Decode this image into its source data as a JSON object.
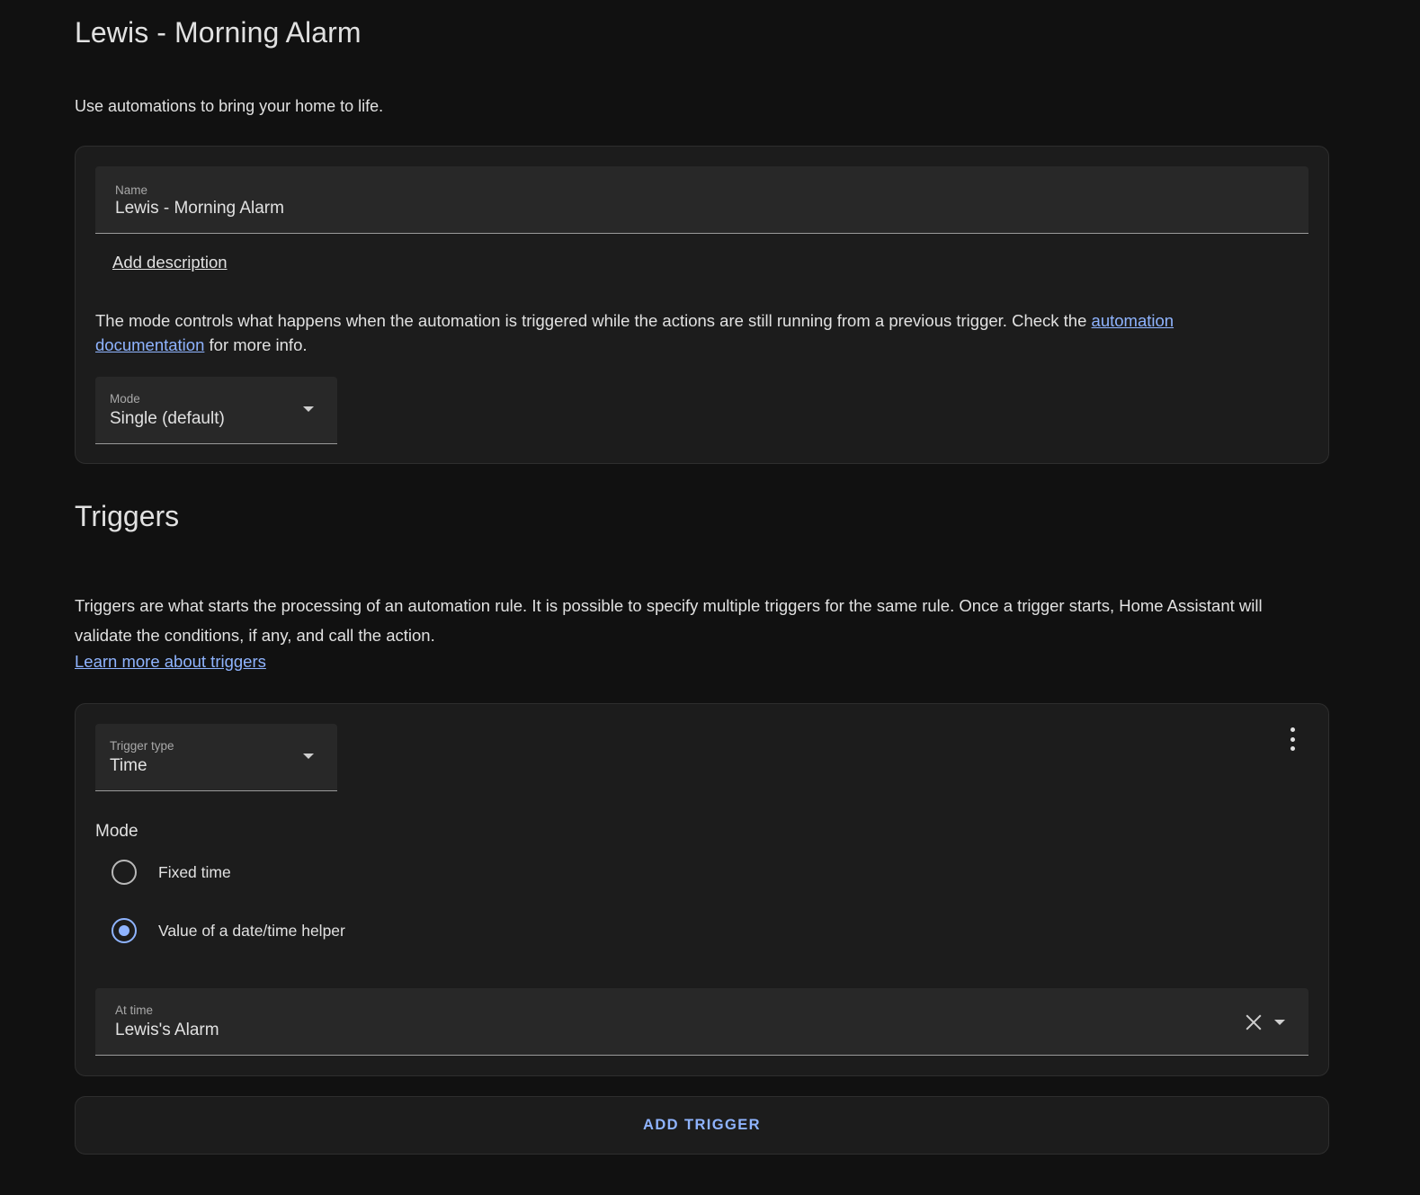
{
  "page": {
    "title": "Lewis - Morning Alarm",
    "intro": "Use automations to bring your home to life."
  },
  "settings_card": {
    "name_label": "Name",
    "name_value": "Lewis - Morning Alarm",
    "add_description": "Add description",
    "mode_help_prefix": "The mode controls what happens when the automation is triggered while the actions are still running from a previous trigger. Check the ",
    "mode_help_link": "automation documentation",
    "mode_help_suffix": " for more info.",
    "mode_label": "Mode",
    "mode_value": "Single (default)"
  },
  "triggers": {
    "title": "Triggers",
    "help": "Triggers are what starts the processing of an automation rule. It is possible to specify multiple triggers for the same rule. Once a trigger starts, Home Assistant will validate the conditions, if any, and call the action.",
    "learn_more": "Learn more about triggers",
    "trigger_card": {
      "type_label": "Trigger type",
      "type_value": "Time",
      "mode_label": "Mode",
      "options": [
        {
          "label": "Fixed time",
          "checked": false
        },
        {
          "label": "Value of a date/time helper",
          "checked": true
        }
      ],
      "at_time_label": "At time",
      "at_time_value": "Lewis's Alarm"
    },
    "add_trigger": "ADD TRIGGER"
  },
  "icons": {
    "menu": "dots-vertical-icon",
    "dropdown": "menu-down-icon",
    "clear": "close-icon"
  },
  "colors": {
    "background": "#111111",
    "card": "#1c1c1c",
    "field": "#282828",
    "accent": "#8fb4ff",
    "text": "#e1e1e1"
  }
}
